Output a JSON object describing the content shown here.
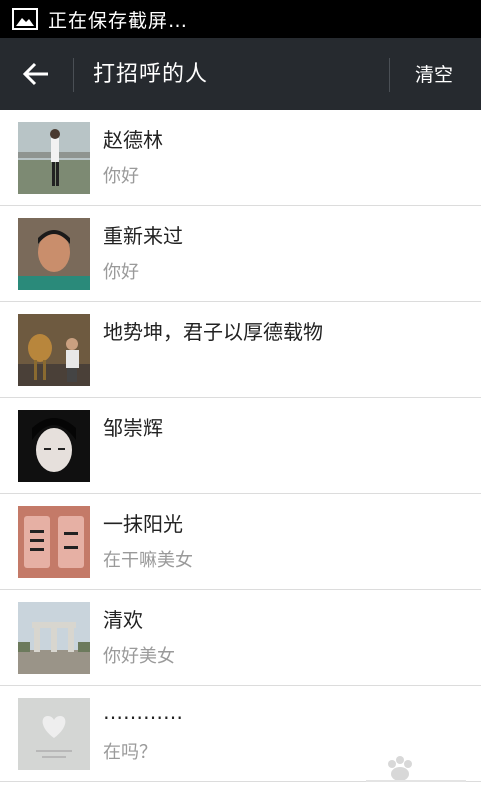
{
  "status_bar": {
    "text": "正在保存截屏…"
  },
  "header": {
    "title": "打招呼的人",
    "clear_label": "清空"
  },
  "contacts": [
    {
      "name": "赵德林",
      "message": "你好"
    },
    {
      "name": "重新来过",
      "message": "你好"
    },
    {
      "name": "地势坤，君子以厚德载物",
      "message": ""
    },
    {
      "name": "邹崇辉",
      "message": ""
    },
    {
      "name": "一抹阳光",
      "message": "在干嘛美女"
    },
    {
      "name": "清欢",
      "message": "你好美女"
    },
    {
      "name": "…………",
      "message": "在吗？"
    }
  ],
  "colors": {
    "status_bar": "#000000",
    "title_bar": "#262a2f",
    "secondary_text": "#9a9a9a"
  }
}
